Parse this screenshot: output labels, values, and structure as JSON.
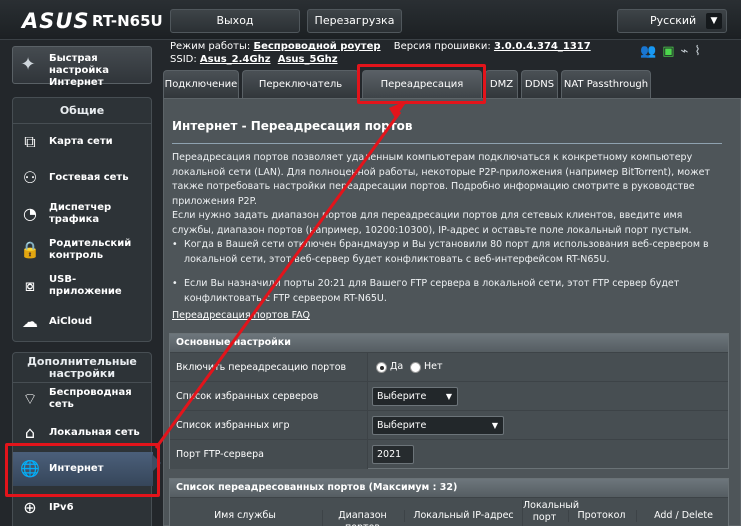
{
  "header": {
    "brand": "ASUS",
    "model": "RT-N65U",
    "logout": "Выход",
    "reboot": "Перезагрузка",
    "language": "Русский"
  },
  "status": {
    "mode_label": "Режим работы:",
    "mode_value": "Беспроводной роутер",
    "firmware_label": "Версия прошивки:",
    "firmware_value": "3.0.0.4.374_1317",
    "ssid_label": "SSID:",
    "ssid_1": "Asus_2.4Ghz",
    "ssid_2": "Asus_5Ghz"
  },
  "sidebar": {
    "quick_setup": "Быстрая настройка Интернет",
    "general_header": "Общие",
    "general_items": [
      {
        "label": "Карта сети",
        "icon": "network-map-icon"
      },
      {
        "label": "Гостевая сеть",
        "icon": "guest-network-icon"
      },
      {
        "label": "Диспетчер трафика",
        "icon": "traffic-manager-icon"
      },
      {
        "label": "Родительский контроль",
        "icon": "parental-control-icon"
      },
      {
        "label": "USB-приложение",
        "icon": "usb-icon"
      },
      {
        "label": "AiCloud",
        "icon": "cloud-icon"
      }
    ],
    "advanced_header": "Дополнительные настройки",
    "advanced_items": [
      {
        "label": "Беспроводная сеть",
        "icon": "wifi-icon"
      },
      {
        "label": "Локальная сеть",
        "icon": "home-icon"
      },
      {
        "label": "Интернет",
        "icon": "globe-icon"
      },
      {
        "label": "IPv6",
        "icon": "ipv6-icon"
      }
    ]
  },
  "tabs": [
    "Подключение",
    "Переключатель портов",
    "Переадресация портов",
    "DMZ",
    "DDNS",
    "NAT Passthrough"
  ],
  "main": {
    "title": "Интернет - Переадресация портов",
    "desc1": "Переадресация портов позволяет удаленным компьютерам подключаться к конкретному компьютеру локальной сети (LAN). Для полноценной работы, некоторые P2P-приложения (например BitTorrent), может также потребовать настройки переадресации портов. Подробно информацию смотрите в руководстве приложения P2P.",
    "desc2": "Если нужно задать диапазон портов для переадресации портов для сетевых клиентов, введите имя службы, диапазон портов (например, 10200:10300), IP-адрес и оставьте поле локальный порт пустым.",
    "bullet1": "Когда в Вашей сети отключен брандмауэр и Вы установили 80 порт для использования веб-сервером в локальной сети, этот веб-сервер будет конфликтовать с веб-интерфейсом RT-N65U.",
    "bullet2": "Если Вы назначили порты 20:21 для Вашего FTP сервера в локальной сети, этот FTP сервер будет конфликтовать с FTP сервером RT-N65U.",
    "faq": "Переадресация портов FAQ"
  },
  "basic": {
    "header": "Основные настройки",
    "enable_label": "Включить переадресацию портов",
    "yes": "Да",
    "no": "Нет",
    "servers_label": "Список избранных серверов",
    "servers_value": "Выберите",
    "games_label": "Список избранных игр",
    "games_value": "Выберите",
    "ftp_label": "Порт FTP-сервера",
    "ftp_value": "2021"
  },
  "list": {
    "header": "Список переадресованных портов (Максимум : 32)",
    "cols": [
      "Имя службы",
      "Диапазон портов",
      "Локальный IP-адрес",
      "Локальный порт",
      "Протокол",
      "Add / Delete"
    ]
  },
  "colors": {
    "annotation": "#e3141b",
    "active_item": "#4b5f7a"
  }
}
